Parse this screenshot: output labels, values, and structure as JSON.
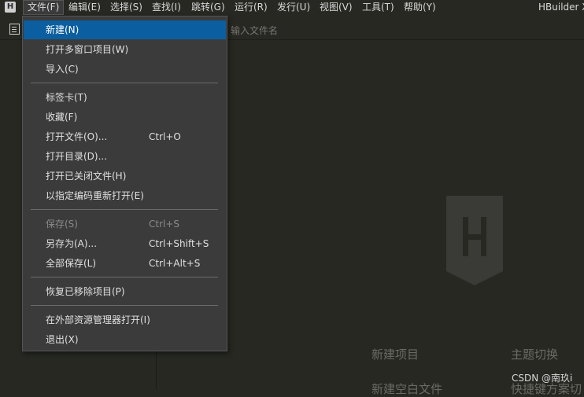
{
  "menubar": {
    "items": [
      "文件(F)",
      "编辑(E)",
      "选择(S)",
      "查找(I)",
      "跳转(G)",
      "运行(R)",
      "发行(U)",
      "视图(V)",
      "工具(T)",
      "帮助(Y)"
    ],
    "app_title": "HBuilder X",
    "logo_letter": "H"
  },
  "toolbar": {
    "search_placeholder": "输入文件名"
  },
  "file_menu": {
    "items": [
      {
        "label": "新建(N)",
        "shortcut": ""
      },
      {
        "label": "打开多窗口项目(W)",
        "shortcut": ""
      },
      {
        "label": "导入(C)",
        "shortcut": ""
      },
      {
        "label": "标签卡(T)",
        "shortcut": ""
      },
      {
        "label": "收藏(F)",
        "shortcut": ""
      },
      {
        "label": "打开文件(O)...",
        "shortcut": "Ctrl+O"
      },
      {
        "label": "打开目录(D)...",
        "shortcut": ""
      },
      {
        "label": "打开已关闭文件(H)",
        "shortcut": ""
      },
      {
        "label": "以指定编码重新打开(E)",
        "shortcut": ""
      },
      {
        "label": "保存(S)",
        "shortcut": "Ctrl+S"
      },
      {
        "label": "另存为(A)...",
        "shortcut": "Ctrl+Shift+S"
      },
      {
        "label": "全部保存(L)",
        "shortcut": "Ctrl+Alt+S"
      },
      {
        "label": "恢复已移除项目(P)",
        "shortcut": ""
      },
      {
        "label": "在外部资源管理器打开(I)",
        "shortcut": ""
      },
      {
        "label": "退出(X)",
        "shortcut": ""
      }
    ]
  },
  "welcome": {
    "new_project": "新建项目",
    "theme_switch": "主题切换",
    "new_empty_file": "新建空白文件",
    "shortcut_scheme": "快捷键方案切"
  },
  "watermark": "CSDN @南玖i",
  "colors": {
    "background": "#272822",
    "menu_bg": "#3b3b3b",
    "highlight": "#0b5e9f"
  }
}
